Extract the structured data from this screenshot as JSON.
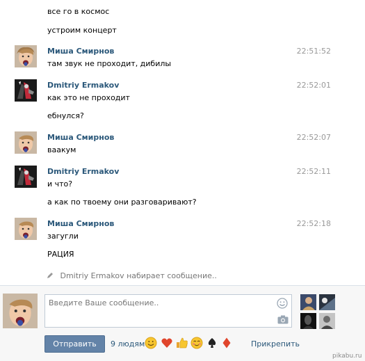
{
  "messages": [
    {
      "author": "",
      "time": "",
      "lines": [
        "все го в космос",
        "устроим концерт"
      ]
    },
    {
      "author": "Миша Смирнов",
      "time": "22:51:52",
      "lines": [
        "там звук не проходит, дибилы"
      ]
    },
    {
      "author": "Dmitriy Ermakov",
      "time": "22:52:01",
      "lines": [
        "как это не проходит",
        "ебнулся?"
      ]
    },
    {
      "author": "Миша Смирнов",
      "time": "22:52:07",
      "lines": [
        "ваакум"
      ]
    },
    {
      "author": "Dmitriy Ermakov",
      "time": "22:52:11",
      "lines": [
        "и что?",
        "а как по твоему они разговаривают?"
      ]
    },
    {
      "author": "Миша Смирнов",
      "time": "22:52:18",
      "lines": [
        "загугли",
        "РАЦИЯ"
      ]
    }
  ],
  "typing": "Dmitriy Ermakov набирает сообщение..",
  "compose": {
    "placeholder": "Введите Ваше сообщение..",
    "send_label": "Отправить",
    "people_count": "9 людям",
    "attach_label": "Прикрепить"
  },
  "emojis": [
    "smile-emoji",
    "heart-emoji",
    "thumbs-up-emoji",
    "blush-emoji",
    "spade-emoji",
    "diamond-emoji"
  ],
  "watermark": "pikabu.ru",
  "colors": {
    "author": "#2b587a",
    "time": "#999999",
    "send_button": "#6383a8",
    "compose_bg": "#f7f7f7",
    "heart": "#e0452c",
    "diamond": "#e0452c"
  }
}
